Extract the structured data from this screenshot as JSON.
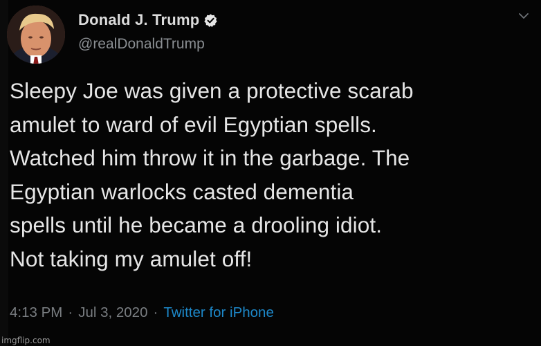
{
  "author": {
    "display_name": "Donald J. Trump",
    "handle": "@realDonaldTrump",
    "verified": true,
    "avatar_icon": "profile-avatar"
  },
  "tweet": {
    "text": "Sleepy Joe was given a protective scarab\namulet to ward of evil Egyptian spells.\nWatched him throw it in the garbage. The\nEgyptian warlocks casted dementia\nspells until he became a drooling idiot.\nNot taking my amulet off!"
  },
  "meta": {
    "time": "4:13 PM",
    "separator": "·",
    "date": "Jul 3, 2020",
    "client": "Twitter for iPhone"
  },
  "icons": {
    "verified": "verified-badge-icon",
    "menu": "chevron-down-icon"
  },
  "watermark": "imgflip.com",
  "colors": {
    "background": "#050505",
    "text": "#e6e6e6",
    "muted": "#7a7e82",
    "link": "#1d88c9"
  }
}
